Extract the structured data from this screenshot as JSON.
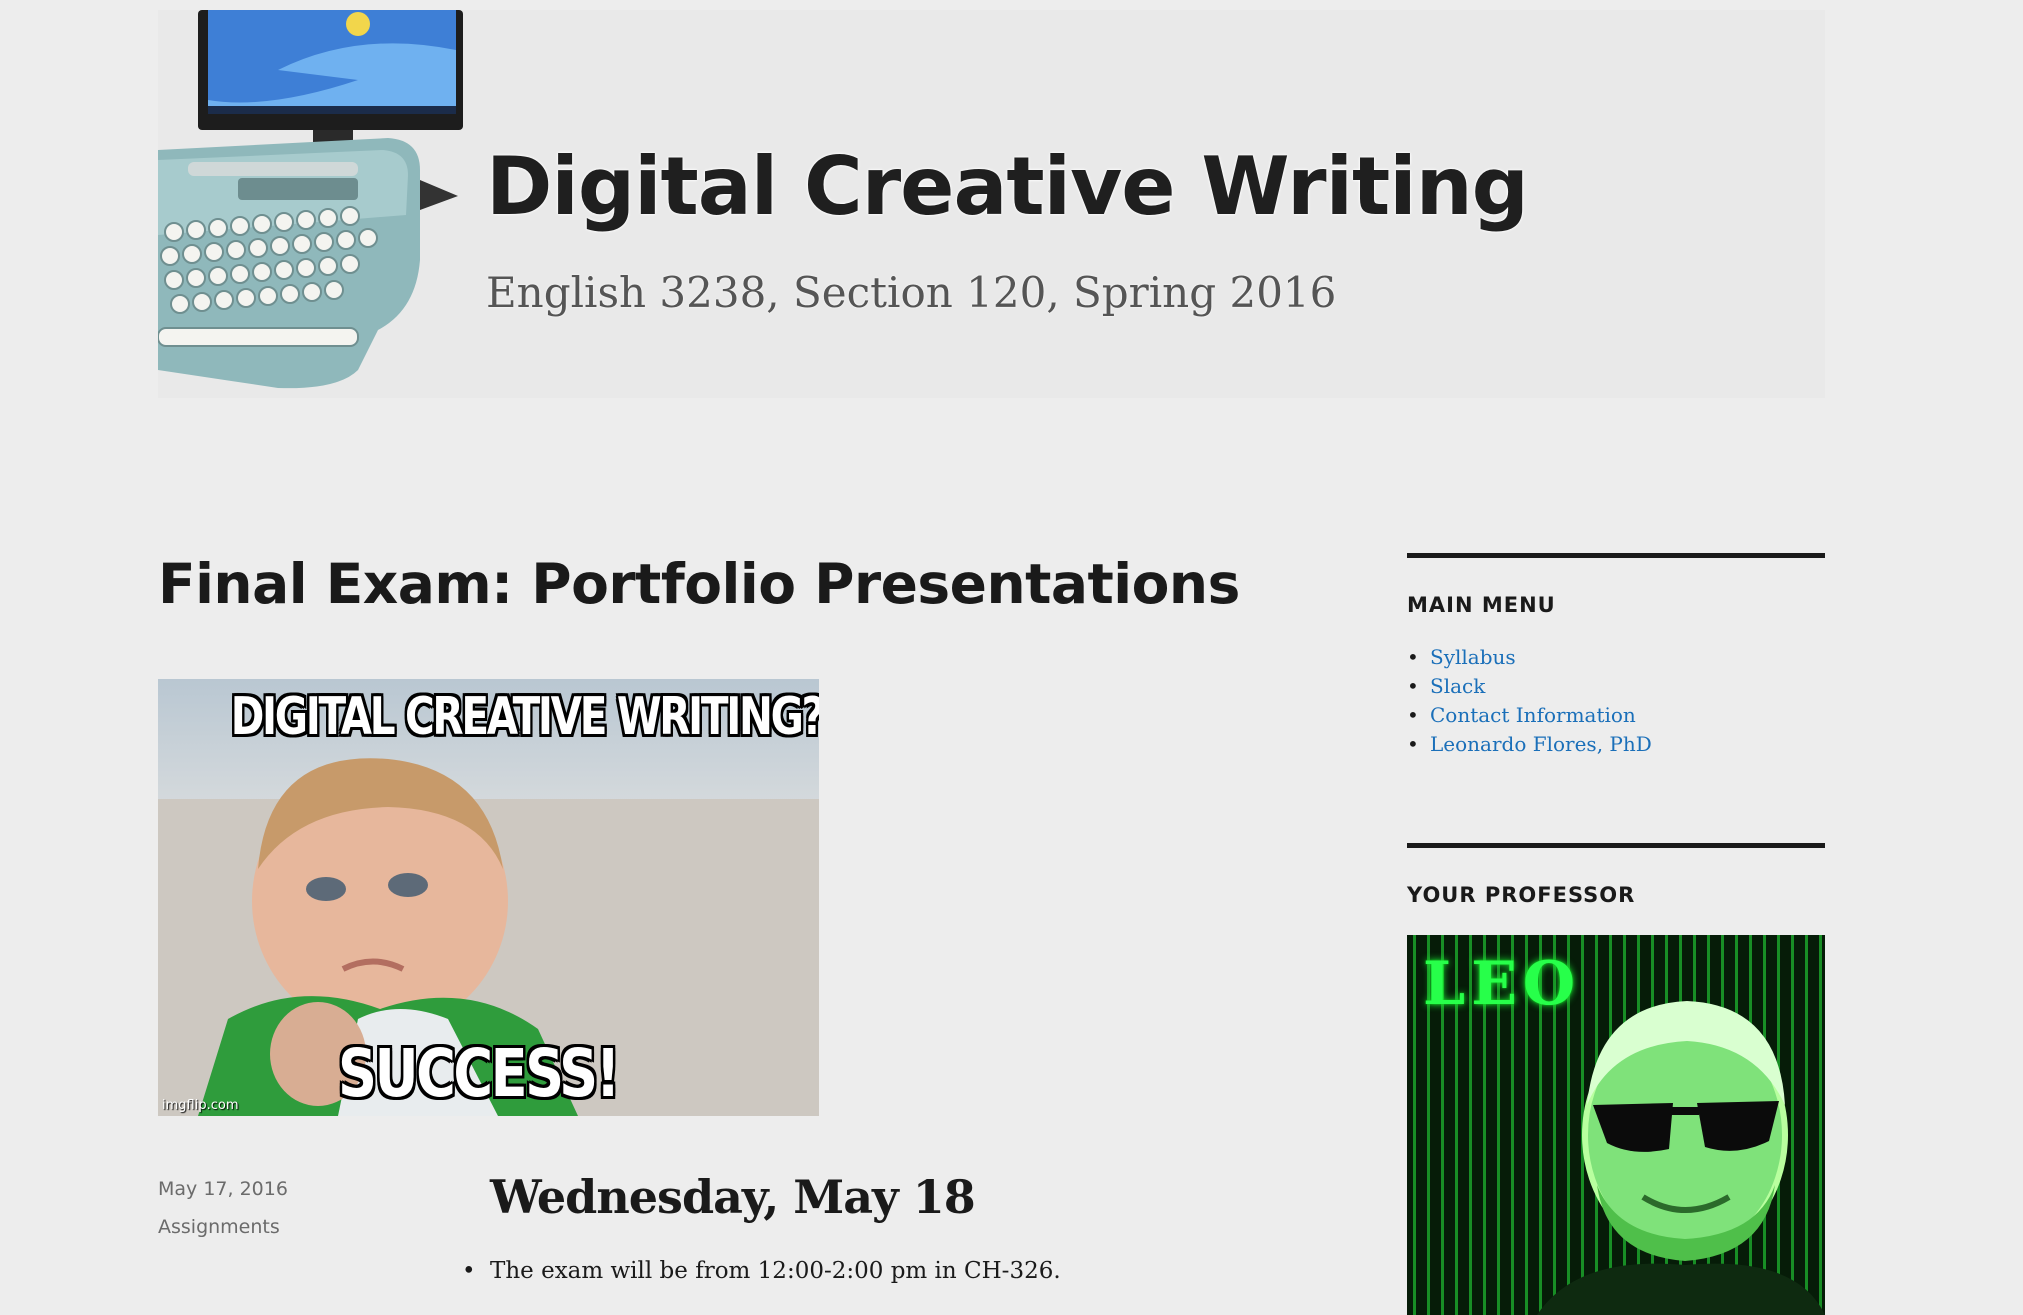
{
  "header": {
    "site_title": "Digital Creative Writing",
    "tagline": "English 3238, Section 120, Spring 2016"
  },
  "article": {
    "title": "Final Exam: Portfolio Presentations",
    "featured_image": {
      "top_text": "DIGITAL CREATIVE WRITING?",
      "bottom_text": "SUCCESS!",
      "watermark": "imgflip.com"
    },
    "meta": {
      "date": "May 17, 2016",
      "category": "Assignments"
    },
    "content": {
      "heading": "Wednesday, May 18",
      "items": [
        "The exam will be from 12:00-2:00 pm in CH-326."
      ]
    }
  },
  "sidebar": {
    "main_menu": {
      "title": "MAIN MENU",
      "items": [
        {
          "label": "Syllabus"
        },
        {
          "label": "Slack"
        },
        {
          "label": "Contact Information"
        },
        {
          "label": "Leonardo Flores, PhD"
        }
      ]
    },
    "professor": {
      "title": "YOUR PROFESSOR",
      "photo_label": "LEO"
    }
  },
  "colors": {
    "background": "#ededed",
    "link": "#1a6fb9",
    "text": "#1a1a1a",
    "meta": "#6b6b6b"
  }
}
